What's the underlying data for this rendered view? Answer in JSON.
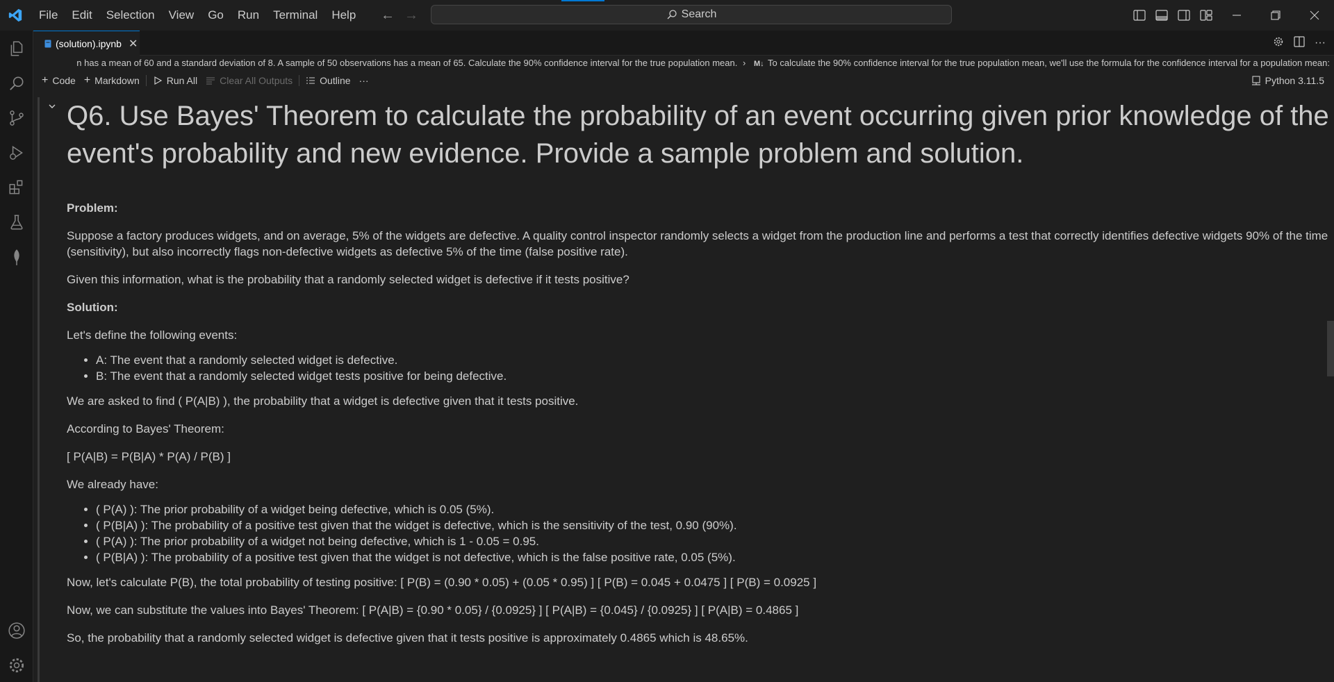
{
  "menu": [
    "File",
    "Edit",
    "Selection",
    "View",
    "Go",
    "Run",
    "Terminal",
    "Help"
  ],
  "search": {
    "label": "Search"
  },
  "tab": {
    "label": "(solution).ipynb",
    "close": "✕"
  },
  "breadcrumb": {
    "part1": "n has a mean of 60 and a standard deviation of 8. A sample of 50 observations has a mean of 65. Calculate the 90% confidence interval for the true population mean.",
    "separator": "›",
    "md_marker": "M↓",
    "part2": "To calculate the 90% confidence interval for the true population mean, we'll use the formula for the confidence interval for a population mean:"
  },
  "toolbar": {
    "code": "Code",
    "markdown": "Markdown",
    "run_all": "Run All",
    "clear_all": "Clear All Outputs",
    "outline": "Outline",
    "more": "···",
    "kernel": "Python 3.11.5"
  },
  "cell": {
    "heading": "Q6. Use Bayes' Theorem to calculate the probability of an event occurring given prior knowledge of the event's probability and new evidence. Provide a sample problem and solution.",
    "problem_label": "Problem:",
    "problem_text": "Suppose a factory produces widgets, and on average, 5% of the widgets are defective. A quality control inspector randomly selects a widget from the production line and performs a test that correctly identifies defective widgets 90% of the time (sensitivity), but also incorrectly flags non-defective widgets as defective 5% of the time (false positive rate).",
    "question": "Given this information, what is the probability that a randomly selected widget is defective if it tests positive?",
    "solution_label": "Solution:",
    "define_intro": "Let's define the following events:",
    "events": [
      "A: The event that a randomly selected widget is defective.",
      "B: The event that a randomly selected widget tests positive for being defective."
    ],
    "asked": "We are asked to find ( P(A|B) ), the probability that a widget is defective given that it tests positive.",
    "according": "According to Bayes' Theorem:",
    "formula": "[ P(A|B) = P(B|A) * P(A) / P(B) ]",
    "already": "We already have:",
    "known": [
      "( P(A) ): The prior probability of a widget being defective, which is 0.05 (5%).",
      "( P(B|A) ): The probability of a positive test given that the widget is defective, which is the sensitivity of the test, 0.90 (90%).",
      "( P(A) ): The prior probability of a widget not being defective, which is 1 - 0.05 = 0.95.",
      "( P(B|A) ): The probability of a positive test given that the widget is not defective, which is the false positive rate, 0.05 (5%)."
    ],
    "pb_calc": "Now, let's calculate P(B), the total probability of testing positive: [ P(B) = (0.90 * 0.05) + (0.05 * 0.95) ] [ P(B) = 0.045 + 0.0475 ] [ P(B) = 0.0925 ]",
    "substitute": "Now, we can substitute the values into Bayes' Theorem: [ P(A|B) = {0.90 * 0.05} / {0.0925} ] [ P(A|B) = {0.045} / {0.0925} ] [ P(A|B) = 0.4865 ]",
    "conclusion": "So, the probability that a randomly selected widget is defective given that it tests positive is approximately 0.4865 which is 48.65%."
  },
  "colors": {
    "accent": "#0078d4",
    "background": "#1f1f1f",
    "text": "#cccccc"
  },
  "icons": [
    "vscode-logo-icon",
    "explorer-icon",
    "search-icon",
    "source-control-icon",
    "run-debug-icon",
    "extensions-icon",
    "testing-icon",
    "leaf-icon",
    "account-icon",
    "settings-gear-icon"
  ]
}
